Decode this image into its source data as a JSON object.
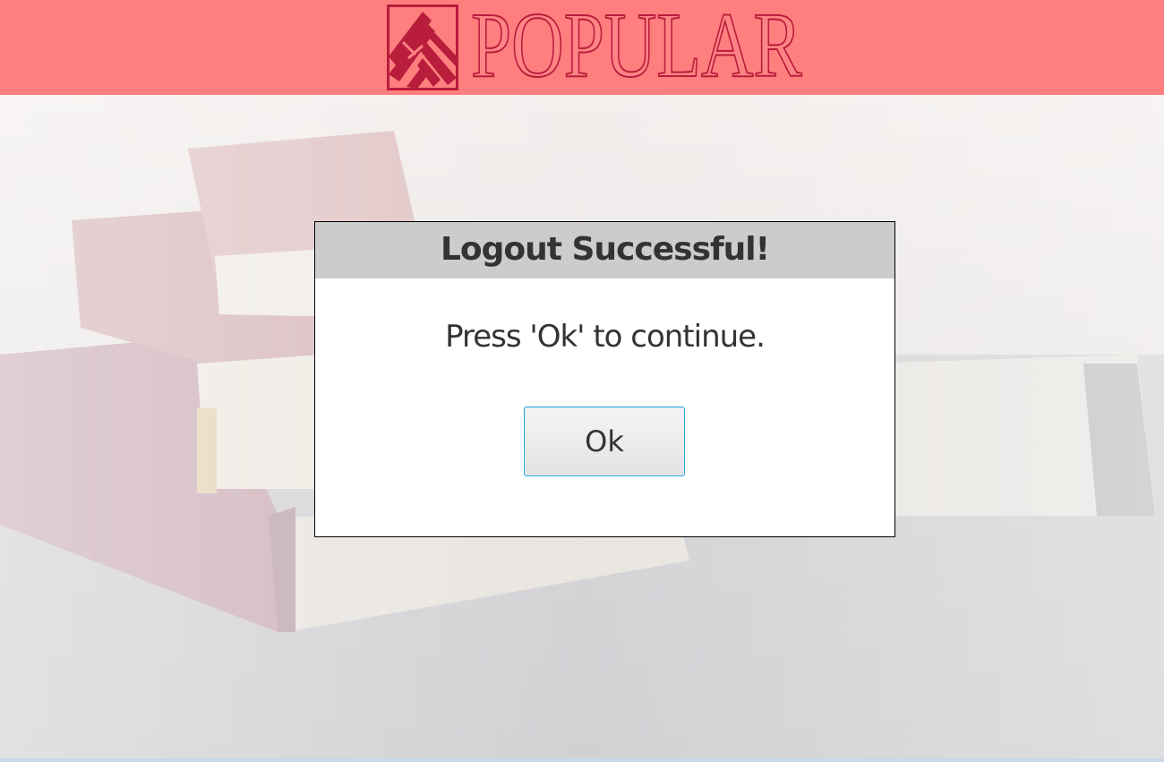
{
  "header": {
    "logo_text": "POPULAR",
    "logo_icon": "popular-logo-mark-icon",
    "background_color": "#ff7f7f",
    "logo_color": "#b81d3b"
  },
  "background": {
    "description_icon": "stacked-books-photo"
  },
  "dialog": {
    "title": "Logout Successful!",
    "message": "Press 'Ok' to continue.",
    "ok_label": "Ok",
    "header_color": "#cccccc",
    "button_border_color": "#2ea6dc"
  }
}
